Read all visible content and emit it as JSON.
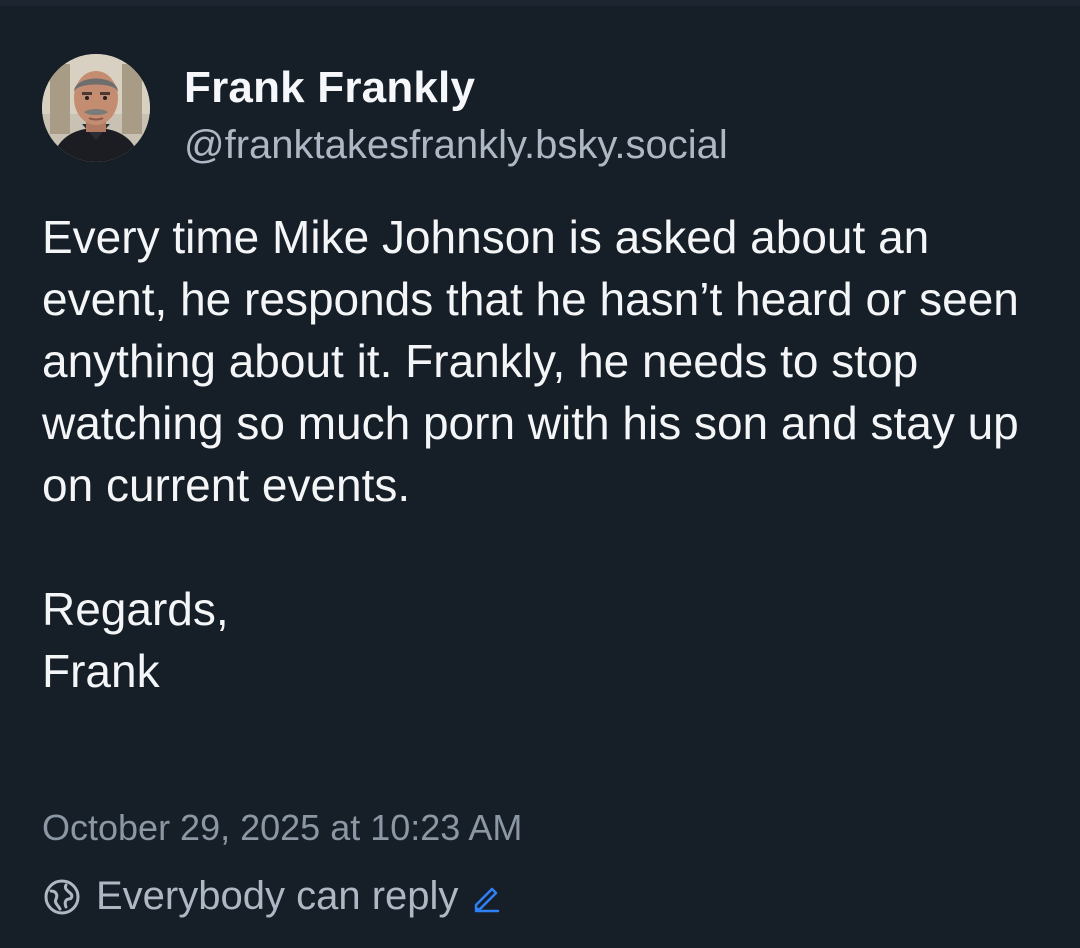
{
  "post": {
    "author": {
      "display_name": "Frank Frankly",
      "handle": "@franktakesfrankly.bsky.social",
      "avatar_icon": "avatar-photo"
    },
    "body": {
      "paragraph1": "Every time Mike Johnson is asked about an event, he responds that he hasn’t heard or seen anything about it. Frankly, he needs to stop watching so much porn with his son and stay up on current events.",
      "paragraph2_line1": "Regards,",
      "paragraph2_line2": "Frank"
    },
    "timestamp": "October 29, 2025 at 10:23 AM",
    "reply_setting": {
      "label": "Everybody can reply",
      "icon": "globe-icon",
      "edit_icon": "pencil-icon"
    }
  },
  "colors": {
    "background": "#161e27",
    "text": "#f3f5f7",
    "muted": "#aeb8c4",
    "timestamp": "#8c97a4",
    "accent": "#2f7ff5"
  }
}
